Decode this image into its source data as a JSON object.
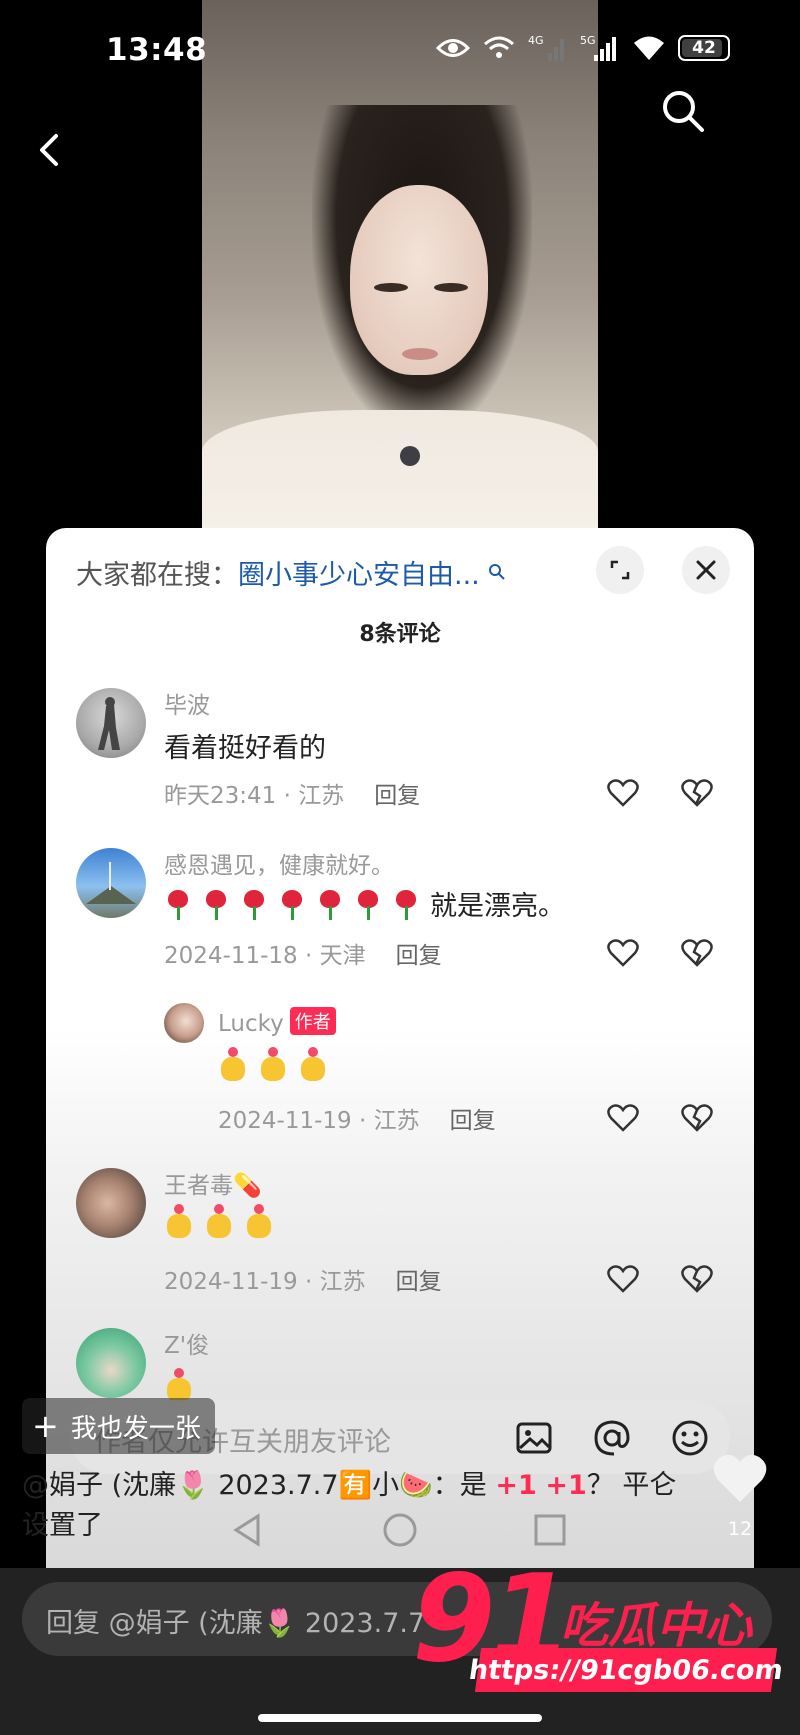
{
  "status_bar": {
    "time": "13:48",
    "battery": "42"
  },
  "sheet": {
    "search_prefix": "大家都在搜：",
    "search_keyword": "圈小事少心安自由...",
    "comment_count": "8条评论"
  },
  "comments": [
    {
      "user": "毕波",
      "text": "看着挺好看的",
      "time_location": "昨天23:41 · 江苏",
      "reply": "回复"
    },
    {
      "user": "感恩遇见，健康就好。",
      "text": "就是漂亮。",
      "emoji": "rose",
      "emoji_count": 7,
      "time_location": "2024-11-18 · 天津",
      "reply": "回复"
    },
    {
      "user": "Lucky",
      "tag": "作者",
      "emoji": "heart-hands",
      "emoji_count": 3,
      "time_location": "2024-11-19 · 江苏",
      "reply": "回复"
    },
    {
      "user": "王者毒💊",
      "emoji": "heart-hands",
      "emoji_count": 3,
      "time_location": "2024-11-19 · 江苏",
      "reply": "回复"
    },
    {
      "user": "Z'俊"
    }
  ],
  "sheet_input": {
    "placeholder": "作者仅允许互关朋友评论"
  },
  "post_pill": {
    "label": "我也发一张"
  },
  "caption": {
    "text_a": "@娟子 (沈廉🌷 2023.7.7🈶小🍉：是 ",
    "pk1": "+1",
    "pk2": "+1",
    "text_b": "？ 平仑设置了"
  },
  "likes": {
    "count": "12"
  },
  "reply_input": {
    "placeholder": "回复 @娟子 (沈廉🌷 2023.7.7"
  },
  "watermark": {
    "number": "91",
    "text": "吃瓜中心",
    "url": "https://91cgb06.com"
  },
  "colors": {
    "accent": "#fe2c55",
    "link": "#1d5aa8",
    "watermark": "#ff1f4e"
  }
}
